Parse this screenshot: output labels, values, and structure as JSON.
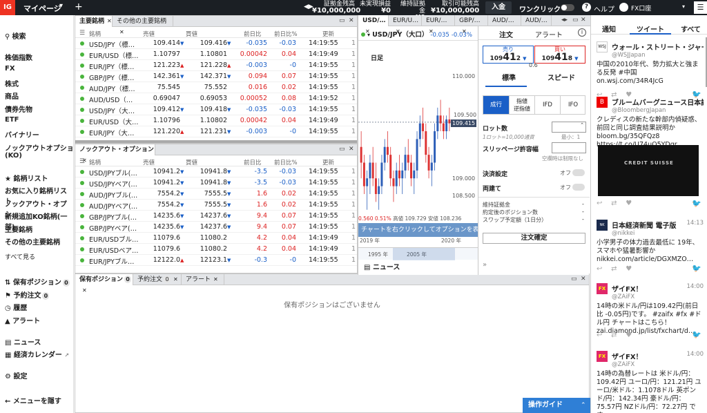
{
  "topbar": {
    "logo": "IG",
    "mypage": "マイページ",
    "acct": [
      {
        "label": "証拠金残高",
        "value": "¥10,000,000"
      },
      {
        "label": "未実現損益",
        "value": "¥0"
      },
      {
        "label": "維持証拠金",
        "value": "¥0"
      },
      {
        "label": "取引可能残高",
        "value": "¥10,000,000"
      }
    ],
    "deposit": "入金",
    "oneclick": "ワンクリック",
    "help": "ヘルプ",
    "user": "FX口座"
  },
  "sidebar": {
    "search": "検索",
    "markets": [
      "株価指数",
      "FX",
      "株式",
      "商品",
      "債券先物",
      "ETF",
      "バイナリー",
      "ノックアウトオプション",
      "(KO)"
    ],
    "watchlists": [
      "銘柄リスト",
      "お気に入り銘柄リスト",
      "ノックアウト・オプシ…",
      "新規追加KO銘柄(一部)",
      "主要銘柄",
      "その他の主要銘柄"
    ],
    "show_all": "すべて見る",
    "positions": "保有ポジション",
    "positions_count": "0",
    "orders": "予約注文",
    "orders_count": "0",
    "history": "履歴",
    "alerts": "アラート",
    "news": "ニュース",
    "calendar": "経済カレンダー",
    "settings": "設定",
    "hide_menu": "← メニューを隠す"
  },
  "main_panel": {
    "tabs": [
      "主要銘柄",
      "その他の主要銘柄"
    ],
    "cols": [
      "銘柄",
      "売値",
      "買値",
      "前日比",
      "前日比%",
      "更新"
    ],
    "rows": [
      {
        "name": "USD/JPY（標…",
        "sell": "109.414",
        "sd": "dn",
        "buy": "109.416",
        "bd": "dn",
        "chg": "-0.035",
        "pct": "-0.03",
        "time": "14:19:55"
      },
      {
        "name": "EUR/USD（標…",
        "sell": "1.10797",
        "sd": "",
        "buy": "1.10801",
        "bd": "",
        "chg": "0.00042",
        "pct": "0.04",
        "time": "14:19:49"
      },
      {
        "name": "EUR/JPY（標…",
        "sell": "121.223",
        "sd": "up",
        "buy": "121.228",
        "bd": "up",
        "chg": "-0.003",
        "pct": "-0",
        "time": "14:19:55"
      },
      {
        "name": "GBP/JPY（標…",
        "sell": "142.361",
        "sd": "dn",
        "buy": "142.371",
        "bd": "dn",
        "chg": "0.094",
        "pct": "0.07",
        "time": "14:19:55"
      },
      {
        "name": "AUD/JPY（標…",
        "sell": "75.545",
        "sd": "",
        "buy": "75.552",
        "bd": "",
        "chg": "0.016",
        "pct": "0.02",
        "time": "14:19:55"
      },
      {
        "name": "AUD/USD（…",
        "sell": "0.69047",
        "sd": "",
        "buy": "0.69053",
        "bd": "",
        "chg": "0.00052",
        "pct": "0.08",
        "time": "14:19:52"
      },
      {
        "name": "USD/JPY（大…",
        "sell": "109.412",
        "sd": "dn",
        "buy": "109.418",
        "bd": "dn",
        "chg": "-0.035",
        "pct": "-0.03",
        "time": "14:19:55"
      },
      {
        "name": "EUR/USD（大…",
        "sell": "1.10796",
        "sd": "",
        "buy": "1.10802",
        "bd": "",
        "chg": "0.00042",
        "pct": "0.04",
        "time": "14:19:49"
      },
      {
        "name": "EUR/JPY（大…",
        "sell": "121.220",
        "sd": "up",
        "buy": "121.231",
        "bd": "dn",
        "chg": "-0.003",
        "pct": "-0",
        "time": "14:19:55"
      }
    ]
  },
  "ko_panel": {
    "tab": "ノックアウト・オプション",
    "cols": [
      "銘柄",
      "売値",
      "買値",
      "前日比",
      "前日比%",
      "更新"
    ],
    "rows": [
      {
        "name": "USD/JPYブル(…",
        "sell": "10941.2",
        "sd": "dn",
        "buy": "10941.8",
        "bd": "dn",
        "chg": "-3.5",
        "pct": "-0.03",
        "time": "14:19:55"
      },
      {
        "name": "USD/JPYベア(…",
        "sell": "10941.2",
        "sd": "dn",
        "buy": "10941.8",
        "bd": "dn",
        "chg": "-3.5",
        "pct": "-0.03",
        "time": "14:19:55"
      },
      {
        "name": "AUD/JPYブル(…",
        "sell": "7554.2",
        "sd": "dn",
        "buy": "7555.5",
        "bd": "dn",
        "chg": "1.6",
        "pct": "0.02",
        "time": "14:19:55"
      },
      {
        "name": "AUD/JPYベア(…",
        "sell": "7554.2",
        "sd": "dn",
        "buy": "7555.5",
        "bd": "dn",
        "chg": "1.6",
        "pct": "0.02",
        "time": "14:19:55"
      },
      {
        "name": "GBP/JPYブル(…",
        "sell": "14235.6",
        "sd": "dn",
        "buy": "14237.6",
        "bd": "dn",
        "chg": "9.4",
        "pct": "0.07",
        "time": "14:19:55"
      },
      {
        "name": "GBP/JPYベア(…",
        "sell": "14235.6",
        "sd": "dn",
        "buy": "14237.6",
        "bd": "dn",
        "chg": "9.4",
        "pct": "0.07",
        "time": "14:19:55"
      },
      {
        "name": "EUR/USDブル…",
        "sell": "11079.6",
        "sd": "",
        "buy": "11080.2",
        "bd": "",
        "chg": "4.2",
        "pct": "0.04",
        "time": "14:19:49"
      },
      {
        "name": "EUR/USDベア…",
        "sell": "11079.6",
        "sd": "",
        "buy": "11080.2",
        "bd": "",
        "chg": "4.2",
        "pct": "0.04",
        "time": "14:19:49"
      },
      {
        "name": "EUR/JPYブル…",
        "sell": "12122.0",
        "sd": "up",
        "buy": "12123.1",
        "bd": "dn",
        "chg": "-0.3",
        "pct": "-0",
        "time": "14:19:55"
      }
    ]
  },
  "bottom_panel": {
    "tabs": [
      {
        "label": "保有ポジション",
        "count": "0"
      },
      {
        "label": "予約注文",
        "count": "0"
      },
      {
        "label": "アラート",
        "count": ""
      }
    ],
    "empty": "保有ポジションはございません"
  },
  "chart_panel": {
    "tabs": [
      "USD/…",
      "EUR/U…",
      "EUR/…",
      "GBP/…",
      "AUD/…",
      "AUD/…"
    ],
    "instrument": "USD/JPY（大口）",
    "change": "-0.035",
    "change_pct": "-0.03%",
    "interval": "日足",
    "price_labels": [
      "110.000",
      "109.500",
      "109.000",
      "108.500"
    ],
    "current_price": "109.415",
    "ohlc": [
      "0.560",
      "0.51%",
      "高値 109.729",
      "安値 108.236"
    ],
    "tooltip": "チャートを右クリックしてオプションを表示",
    "years_top": [
      "2019 年",
      "2020 年"
    ],
    "years_nav": [
      "1995 年",
      "2005 年"
    ],
    "news": "ニュース"
  },
  "order_panel": {
    "tab_order": "注文",
    "tab_alert": "アラート",
    "sell_label": "売り",
    "sell_prefix": "109",
    "sell_big": "41",
    "sell_suffix": "2",
    "buy_label": "買い",
    "buy_prefix": "109",
    "buy_big": "41",
    "buy_suffix": "8",
    "spread": "0.6",
    "mode_std": "標準",
    "mode_speed": "スピード",
    "types": [
      "成行",
      "指値\n逆指値",
      "IFD",
      "IFO"
    ],
    "lot_label": "ロット数",
    "lot_hint": "1ロット=10,000通貨",
    "lot_min": "最小：1",
    "slip_label": "スリッページ許容幅",
    "slip_hint": "空欄時は制限なし",
    "settle_label": "決済設定",
    "settle_val": "オフ",
    "both_label": "両建て",
    "both_val": "オフ",
    "margin_label": "維持証拠金",
    "margin_val": "-",
    "pos_label": "約定後のポジション数",
    "pos_val": "-",
    "swap_label": "スワップ予定額（1日分）",
    "swap_val": "-",
    "confirm": "注文確定"
  },
  "feed": {
    "tabs": [
      "通知",
      "ツイート",
      "すべて"
    ],
    "tweets": [
      {
        "name": "ウォール・ストリート・ジャーナ",
        "handle": "@WSJJapan",
        "time": "",
        "text": "中国の2010年代、勢力拡大と強まる反発 #中国 on.wsj.com/34R4JcG"
      },
      {
        "name": "ブルームバーグニュース日本語版",
        "handle": "@BloombergJapan",
        "time": "",
        "text": "クレディスの新たな幹部内偵疑惑、前回と同じ調査結果説明か bloom.bg/35QFQz8 https://t.co/U74uQ5YDgr"
      },
      {
        "name": "日本経済新聞 電子版",
        "handle": "@nikkei",
        "time": "14:13",
        "text": "小学男子の体力過去最低に 19年、スマホや猛暑影響か nikkei.com/article/DGXMZO…"
      },
      {
        "name": "ザイFX！",
        "handle": "@ZAiFX",
        "time": "14:00",
        "text": "14時の米ドル/円は109.42円(前日比 -0.05円)です。 #zaifx #fx #ドル円 チャートはこちら！ zai.diamond.jp/list/fxchart/d…"
      },
      {
        "name": "ザイFX！",
        "handle": "@ZAiFX",
        "time": "14:00",
        "text": "14時の為替レートは 米ドル/円：109.42円 ユーロ/円：121.21円 ユーロ/米ドル：1.1078ドル 英ポンド/円：142.34円 豪ドル/円：75.57円 NZドル/円：72.27円 です。"
      }
    ],
    "guide": "操作ガイド"
  },
  "colors": {
    "accent": "#1a5fc7",
    "up": "#d22222",
    "down": "#1a5fc7",
    "topbar": "#1b1f24",
    "guide": "#2f7fd6"
  },
  "chart_data": {
    "type": "candlestick",
    "yrange": [
      108.236,
      110.1
    ],
    "candles": [
      [
        109.1,
        109.3,
        108.7,
        108.9
      ],
      [
        108.9,
        109.0,
        108.5,
        108.6
      ],
      [
        108.6,
        108.8,
        108.3,
        108.7
      ],
      [
        108.7,
        109.0,
        108.5,
        108.9
      ],
      [
        108.9,
        109.1,
        108.6,
        108.7
      ],
      [
        108.7,
        108.9,
        108.4,
        108.5
      ],
      [
        108.5,
        108.7,
        108.3,
        108.6
      ],
      [
        108.6,
        109.0,
        108.5,
        108.9
      ],
      [
        108.9,
        109.2,
        108.8,
        109.1
      ],
      [
        109.1,
        109.3,
        108.9,
        109.0
      ],
      [
        109.0,
        109.1,
        108.6,
        108.7
      ],
      [
        108.7,
        108.8,
        108.4,
        108.6
      ],
      [
        108.6,
        108.9,
        108.5,
        108.8
      ],
      [
        108.8,
        109.0,
        108.6,
        108.7
      ],
      [
        108.7,
        108.9,
        108.5,
        108.8
      ],
      [
        108.8,
        109.1,
        108.7,
        109.0
      ],
      [
        109.0,
        109.2,
        108.8,
        108.9
      ],
      [
        108.9,
        109.0,
        108.6,
        108.7
      ],
      [
        108.7,
        108.9,
        108.5,
        108.8
      ],
      [
        108.8,
        109.3,
        108.7,
        109.2
      ],
      [
        109.2,
        109.5,
        109.1,
        109.4
      ],
      [
        109.4,
        109.6,
        109.2,
        109.3
      ],
      [
        109.3,
        109.4,
        108.9,
        109.0
      ],
      [
        109.0,
        109.1,
        108.7,
        108.8
      ],
      [
        108.8,
        109.0,
        108.6,
        108.9
      ],
      [
        108.9,
        109.4,
        108.8,
        109.3
      ],
      [
        109.3,
        109.6,
        109.2,
        109.5
      ],
      [
        109.5,
        109.7,
        109.3,
        109.4
      ],
      [
        109.4,
        109.5,
        109.2,
        109.3
      ],
      [
        109.3,
        109.5,
        109.2,
        109.45
      ],
      [
        109.45,
        109.6,
        109.3,
        109.4
      ]
    ]
  }
}
